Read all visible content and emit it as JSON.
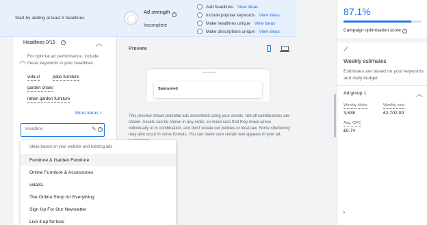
{
  "banner": {
    "instruction": "Start by adding at least 5 headlines",
    "strength_label": "Ad strength",
    "strength_status": "Incomplete",
    "tips": [
      {
        "text": "Add headlines",
        "link": "View ideas"
      },
      {
        "text": "Include popular keywords",
        "link": "View ideas"
      },
      {
        "text": "Make headlines unique",
        "link": "View ideas"
      },
      {
        "text": "Make descriptions unique",
        "link": "View ideas"
      }
    ]
  },
  "headlines": {
    "title": "Headlines 0/15",
    "description": "For optimal ad performance, include these keywords in your headlines",
    "keywords": [
      "vida xl",
      "patio furniture",
      "garden chairs",
      "rattan garden furniture"
    ],
    "more_ideas": "More ideas",
    "field_placeholder": "Headline"
  },
  "suggestions": {
    "header": "Ideas based on your website and existing ads",
    "items": [
      "Furniture & Garden Furniture",
      "Online Furniture & Accessories",
      "vidaXL",
      "The Online Shop for Everything",
      "Sign Up For Our Newsletter",
      "Live it up for less"
    ]
  },
  "preview": {
    "title": "Preview",
    "ad_label": "Sponsored",
    "disclaimer": "This preview shows potential ads assembled using your assets. Not all combinations are shown. Assets can be shown in any order, so make sure that they make sense individually or in combination, and don't violate our policies or local law. Some shortening may also occur in some formats. You can make sure certain text appears in your ad.",
    "learn_more": "Learn more"
  },
  "sidebar": {
    "score": "87.1%",
    "score_fraction": 0.871,
    "score_label": "Campaign optimisation score",
    "estimates_title": "Weekly estimates",
    "estimates_desc": "Estimates are based on your keywords and daily budget",
    "ad_group": "Ad group 1",
    "metrics": [
      {
        "label": "Weekly clicks",
        "value": "3,638"
      },
      {
        "label": "Weekly cost",
        "value": "£2,702.00"
      },
      {
        "label": "Avg. CPC",
        "value": "£0.74"
      }
    ]
  },
  "colors": {
    "accent": "#1a73e8",
    "banner_bg": "#e8f0fe",
    "panel_bg": "#f1f3f4"
  }
}
